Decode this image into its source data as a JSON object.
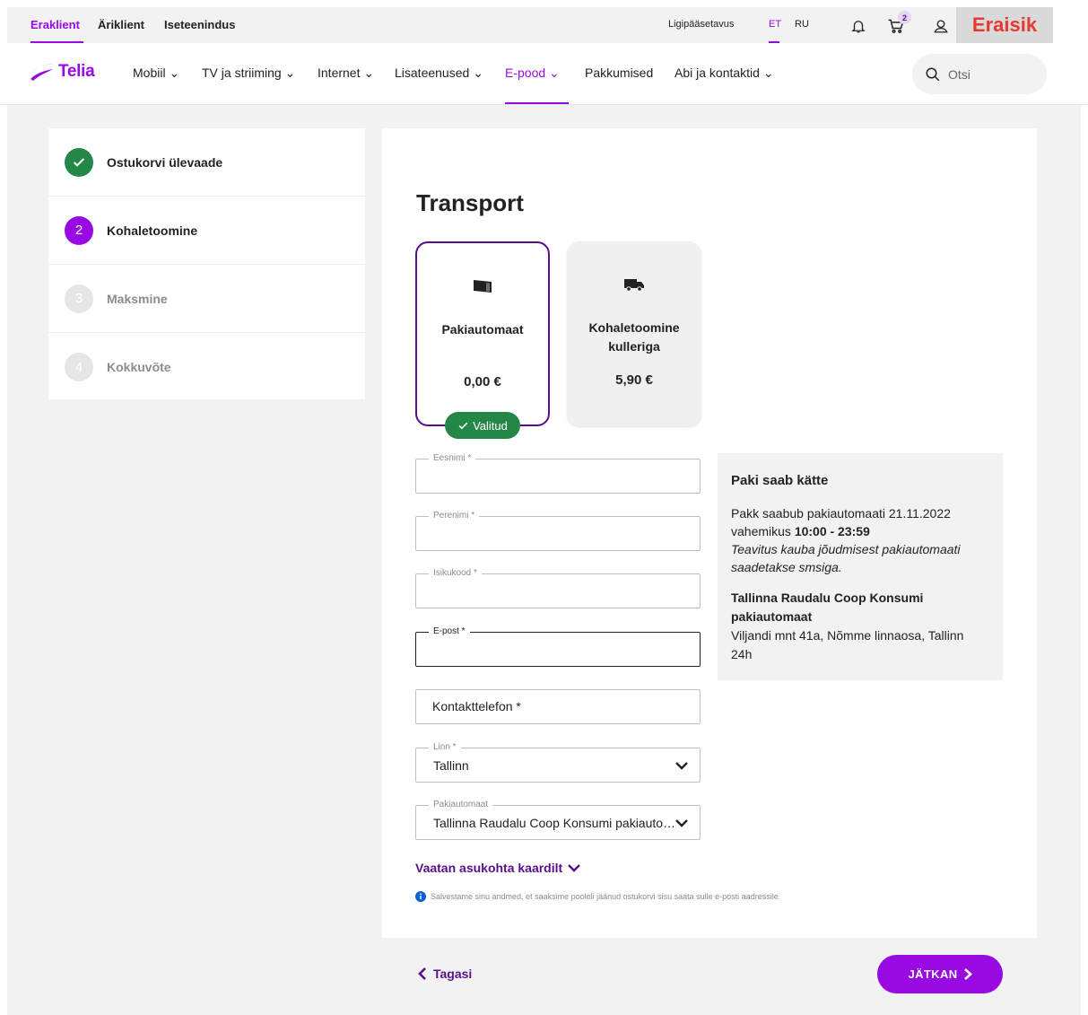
{
  "utility_bar": {
    "segments": [
      "Eraklient",
      "Äriklient",
      "Iseteenindus"
    ],
    "active_segment": "Eraklient",
    "accessibility": "Ligipääsetavus",
    "languages": [
      "ET",
      "RU"
    ],
    "active_language": "ET",
    "cart_count": "2",
    "account_label": "Eraisik"
  },
  "brand": {
    "logo_text": "Telia"
  },
  "main_nav": {
    "items": [
      "Mobiil",
      "TV ja striiming",
      "Internet",
      "Lisateenused",
      "E-pood",
      "Pakkumised",
      "Abi ja kontaktid"
    ],
    "active_item": "E-pood",
    "search_placeholder": "Otsi"
  },
  "checkout_steps": [
    {
      "number": "",
      "label": "Ostukorvi ülevaade",
      "state": "done"
    },
    {
      "number": "2",
      "label": "Kohaletoomine",
      "state": "current"
    },
    {
      "number": "3",
      "label": "Maksmine",
      "state": "todo"
    },
    {
      "number": "4",
      "label": "Kokkuvõte",
      "state": "todo"
    }
  ],
  "transport": {
    "title": "Transport",
    "options": [
      {
        "name": "Pakiautomaat",
        "price": "0,00 €",
        "selected": true,
        "icon": "parcel-locker-icon"
      },
      {
        "name": "Kohaletoomine kulleriga",
        "price": "5,90 €",
        "selected": false,
        "icon": "truck-icon"
      }
    ],
    "selected_badge": "Valitud"
  },
  "form": {
    "first_name_label": "Eesnimi *",
    "last_name_label": "Perenimi *",
    "id_code_label": "Isikukood *",
    "email_label": "E-post *",
    "phone_placeholder": "Kontakttelefon *",
    "city_label": "Linn *",
    "city_value": "Tallinn",
    "locker_label": "Pakiautomaat",
    "locker_value": "Tallinna Raudalu Coop Konsumi pakiautomaat",
    "map_link": "Vaatan asukohta kaardilt",
    "info_note": "Salvestame sinu andmed, et saaksime pooleli jäänud ostukorvi sisu saata sulle e-posti aadressile."
  },
  "delivery_info": {
    "heading": "Paki saab kätte",
    "arrival_text": "Pakk saabub pakiautomaati 21.11.2022 vahemikus",
    "time_window": "10:00 - 23:59",
    "notice": "Teavitus kauba jõudmisest pakiautomaati saadetakse smsiga.",
    "location_name": "Tallinna Raudalu Coop Konsumi pakiautomaat",
    "location_address": "Viljandi mnt 41a, Nõmme linnaosa, Tallinn",
    "location_hours": "24h"
  },
  "footer": {
    "back_label": "Tagasi",
    "next_label": "JÄTKAN"
  },
  "colors": {
    "brand_purple": "#990ae3",
    "deep_purple": "#5a0f8a",
    "success_green": "#238746",
    "account_red": "#e8382f"
  }
}
